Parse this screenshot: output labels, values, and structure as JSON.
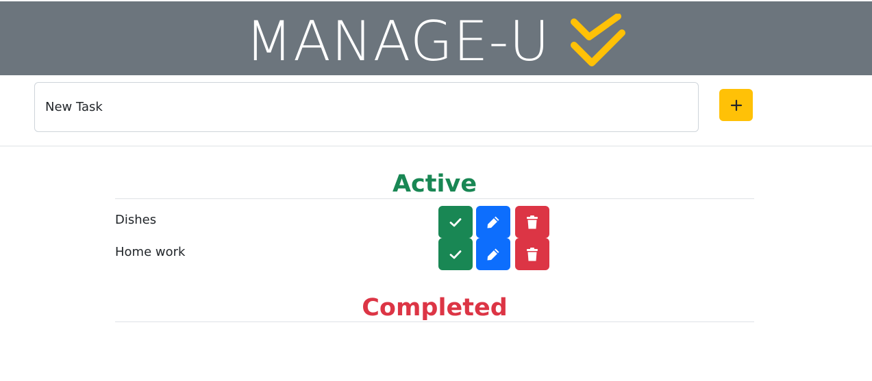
{
  "app": {
    "title": "MANAGE-U",
    "accent_color": "#ffc107",
    "header_color": "#6c757d",
    "logo_icon": "double-check-icon"
  },
  "new_task": {
    "value": "",
    "placeholder": "New Task",
    "add_icon": "plus-icon"
  },
  "sections": {
    "active": {
      "title": "Active",
      "color": "#198754"
    },
    "completed": {
      "title": "Completed",
      "color": "#dc3545"
    }
  },
  "active_tasks": [
    {
      "label": "Dishes"
    },
    {
      "label": "Home work"
    }
  ],
  "completed_tasks": [],
  "task_actions": [
    {
      "icon": "check-icon",
      "color": "#198754"
    },
    {
      "icon": "pencil-icon",
      "color": "#0d6efd"
    },
    {
      "icon": "trash-icon",
      "color": "#dc3545"
    }
  ]
}
